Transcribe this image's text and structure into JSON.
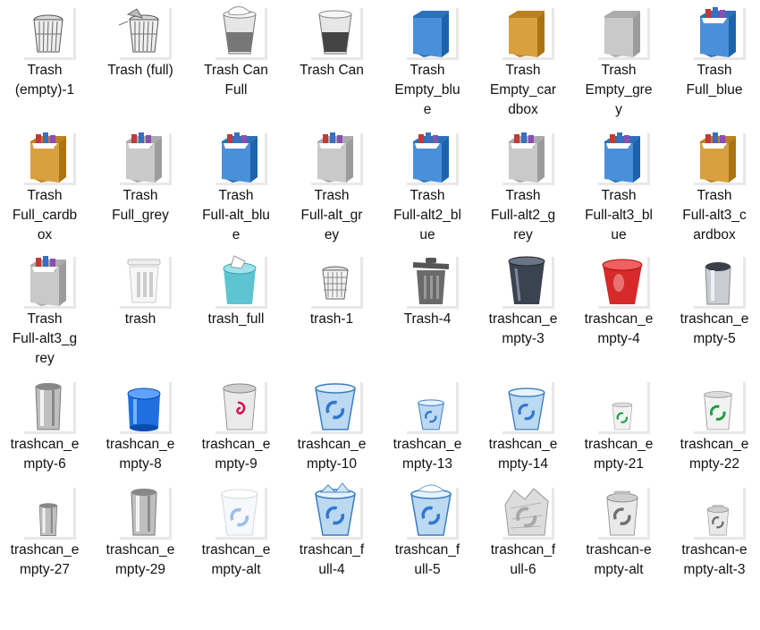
{
  "icons": [
    {
      "label": "Trash\n(empty)-1",
      "icon": "wire-trash-empty-icon",
      "style": "wire"
    },
    {
      "label": "Trash (full)",
      "icon": "wire-trash-full-icon",
      "style": "wirefull"
    },
    {
      "label": "Trash Can\nFull",
      "icon": "glass-can-full-icon",
      "style": "glassfull"
    },
    {
      "label": "Trash Can",
      "icon": "glass-can-icon",
      "style": "glass"
    },
    {
      "label": "Trash\nEmpty_blu\ne",
      "icon": "blue-box-icon",
      "style": "box",
      "color": "#4a90d9"
    },
    {
      "label": "Trash\nEmpty_car\ndbox",
      "icon": "cardboard-box-icon",
      "style": "box",
      "color": "#d9a040"
    },
    {
      "label": "Trash\nEmpty_gre\ny",
      "icon": "grey-box-icon",
      "style": "box",
      "color": "#c9c9c9"
    },
    {
      "label": "Trash\nFull_blue",
      "icon": "blue-box-full-icon",
      "style": "boxfull",
      "color": "#4a90d9"
    },
    {
      "label": "Trash\nFull_cardb\nox",
      "icon": "cardboard-box-full-icon",
      "style": "boxfull",
      "color": "#d9a040"
    },
    {
      "label": "Trash\nFull_grey",
      "icon": "grey-box-full-icon",
      "style": "boxfull",
      "color": "#c9c9c9"
    },
    {
      "label": "Trash\nFull-alt_blu\ne",
      "icon": "blue-box-full-alt-icon",
      "style": "boxfull",
      "color": "#4a90d9"
    },
    {
      "label": "Trash\nFull-alt_gr\ney",
      "icon": "grey-box-full-alt-icon",
      "style": "boxfull",
      "color": "#c9c9c9"
    },
    {
      "label": "Trash\nFull-alt2_bl\nue",
      "icon": "blue-box-full-alt2-icon",
      "style": "boxfull",
      "color": "#4a90d9"
    },
    {
      "label": "Trash\nFull-alt2_g\nrey",
      "icon": "grey-box-full-alt2-icon",
      "style": "boxfull",
      "color": "#c9c9c9"
    },
    {
      "label": "Trash\nFull-alt3_bl\nue",
      "icon": "blue-box-full-alt3-icon",
      "style": "boxfull",
      "color": "#4a90d9"
    },
    {
      "label": "Trash\nFull-alt3_c\nardbox",
      "icon": "cardboard-box-full-alt3-icon",
      "style": "boxfull",
      "color": "#d9a040"
    },
    {
      "label": "Trash\nFull-alt3_g\nrey",
      "icon": "grey-box-full-alt3-icon",
      "style": "boxfull",
      "color": "#c9c9c9"
    },
    {
      "label": "trash",
      "icon": "white-bin-icon",
      "style": "whitebin"
    },
    {
      "label": "trash_full",
      "icon": "teal-bin-full-icon",
      "style": "tealfull"
    },
    {
      "label": "trash-1",
      "icon": "mesh-bin-icon",
      "style": "mesh"
    },
    {
      "label": "Trash-4",
      "icon": "grey-lid-bin-icon",
      "style": "lidbin"
    },
    {
      "label": "trashcan_e\nmpty-3",
      "icon": "dark-glass-can-icon",
      "style": "darkcan"
    },
    {
      "label": "trashcan_e\nmpty-4",
      "icon": "red-can-icon",
      "style": "redcan"
    },
    {
      "label": "trashcan_e\nmpty-5",
      "icon": "steel-can-icon",
      "style": "steelcan"
    },
    {
      "label": "trashcan_e\nmpty-6",
      "icon": "chrome-tube-icon",
      "style": "chrome"
    },
    {
      "label": "trashcan_e\nmpty-8",
      "icon": "blue-plastic-can-icon",
      "style": "bluecan"
    },
    {
      "label": "trashcan_e\nmpty-9",
      "icon": "debian-can-icon",
      "style": "debian"
    },
    {
      "label": "trashcan_e\nmpty-10",
      "icon": "recycle-bin-blue-icon",
      "style": "recycle",
      "size": 1.0
    },
    {
      "label": "trashcan_e\nmpty-13",
      "icon": "recycle-bin-small-icon",
      "style": "recycle",
      "size": 0.65
    },
    {
      "label": "trashcan_e\nmpty-14",
      "icon": "recycle-bin-glass-icon",
      "style": "recycle",
      "size": 0.9
    },
    {
      "label": "trashcan_e\nmpty-21",
      "icon": "green-recycle-small-icon",
      "style": "greenrecycle",
      "size": 0.6
    },
    {
      "label": "trashcan_e\nmpty-22",
      "icon": "green-recycle-icon",
      "style": "greenrecycle",
      "size": 0.85
    },
    {
      "label": "trashcan_e\nmpty-27",
      "icon": "small-chrome-can-icon",
      "style": "chrome",
      "size": 0.7
    },
    {
      "label": "trashcan_e\nmpty-29",
      "icon": "tall-chrome-can-icon",
      "style": "chrome",
      "size": 1.0
    },
    {
      "label": "trashcan_e\nmpty-alt",
      "icon": "frosted-recycle-can-icon",
      "style": "frosted"
    },
    {
      "label": "trashcan_f\null-4",
      "icon": "recycle-bin-full-icon",
      "style": "recyclefull",
      "size": 1.0
    },
    {
      "label": "trashcan_f\null-5",
      "icon": "recycle-bin-full-alt-icon",
      "style": "recyclefull2",
      "size": 1.0
    },
    {
      "label": "trashcan_f\null-6",
      "icon": "paper-pile-recycle-icon",
      "style": "paperpile"
    },
    {
      "label": "trashcan-e\nmpty-alt",
      "icon": "grey-recycle-can-icon",
      "style": "greyrecycle",
      "size": 0.95
    },
    {
      "label": "trashcan-e\nmpty-alt-3",
      "icon": "grey-recycle-can-small-icon",
      "style": "greyrecycle",
      "size": 0.65
    }
  ]
}
